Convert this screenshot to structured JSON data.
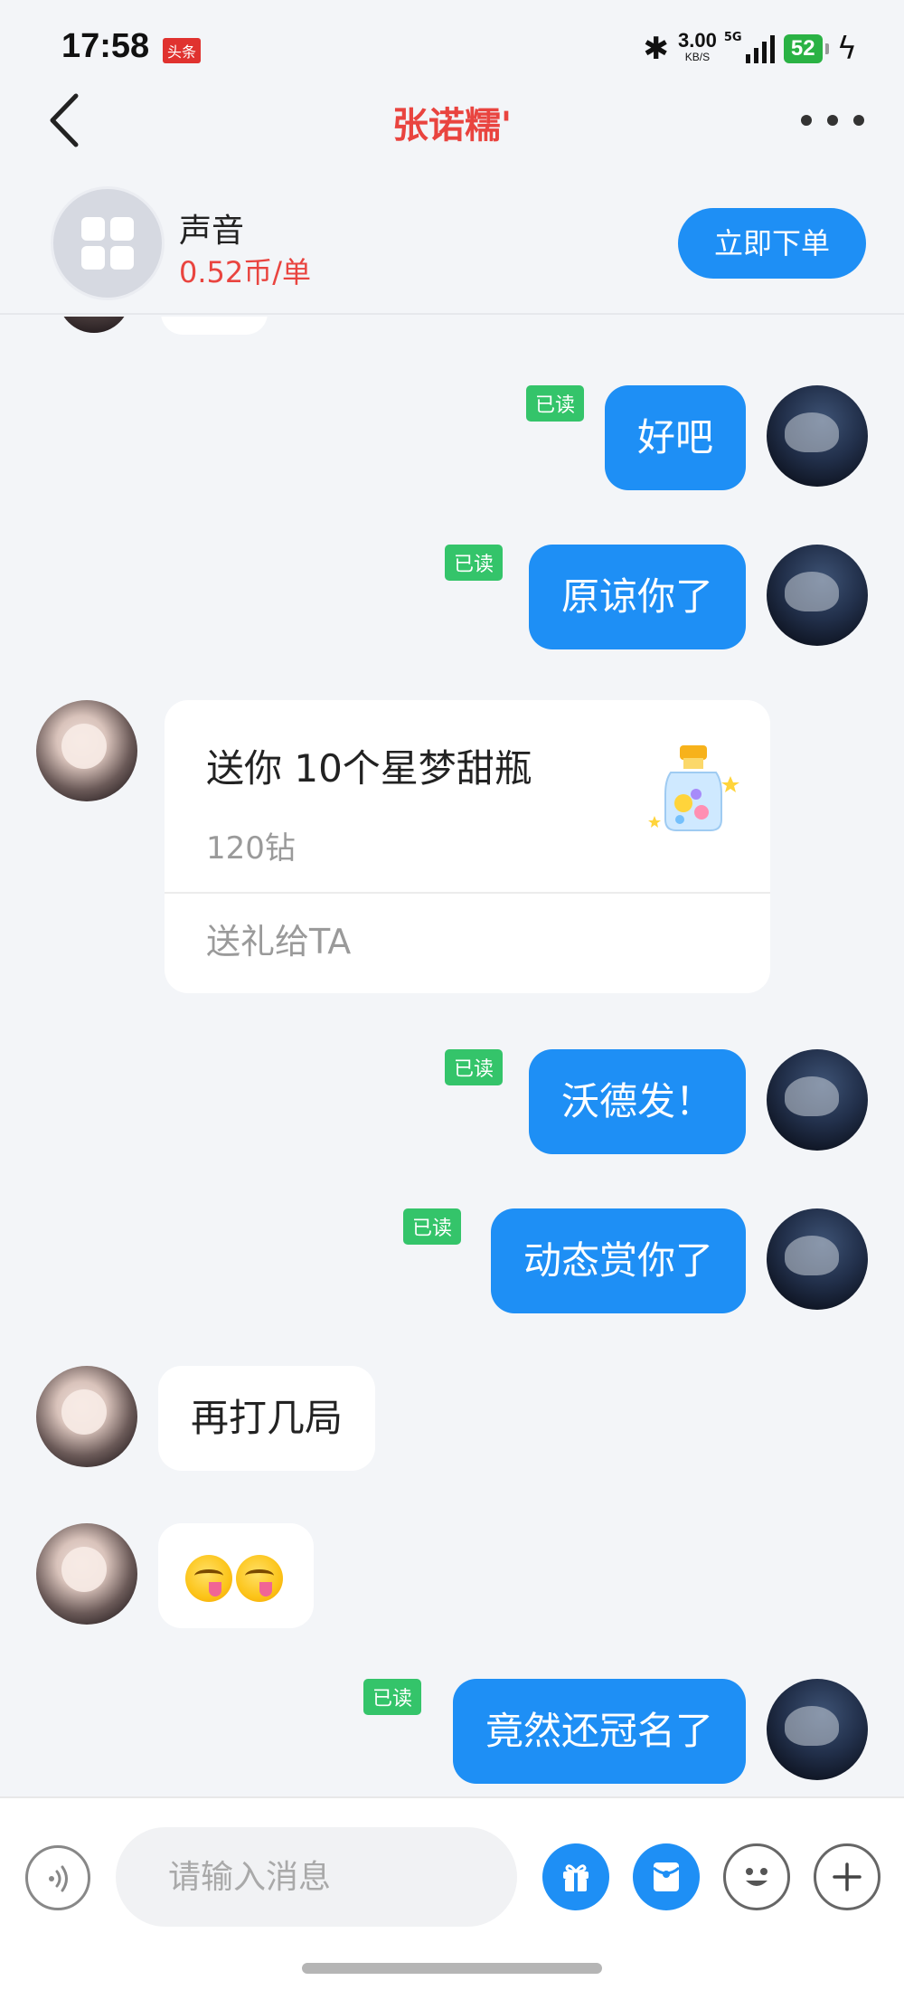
{
  "status_bar": {
    "time": "17:58",
    "news_badge": "头条",
    "speed_value": "3.00",
    "speed_unit": "KB/S",
    "network": "5G",
    "battery": "52"
  },
  "header": {
    "title": "张诺糯'"
  },
  "service": {
    "name": "声音",
    "price": "0.52币/单",
    "order_label": "立即下单"
  },
  "read_label": "已读",
  "messages": [
    {
      "from": "me",
      "text": "好吧",
      "read": true
    },
    {
      "from": "me",
      "text": "原谅你了",
      "read": true
    },
    {
      "from": "her",
      "type": "gift",
      "title": "送你 10个星梦甜瓶",
      "price": "120钻",
      "action": "送礼给TA"
    },
    {
      "from": "me",
      "text": "沃德发！",
      "read": true
    },
    {
      "from": "me",
      "text": "动态赏你了",
      "read": true
    },
    {
      "from": "her",
      "text": "再打几局"
    },
    {
      "from": "her",
      "type": "emoji",
      "emoji_name": "yum-face-icon",
      "emoji_count": 2
    },
    {
      "from": "me",
      "text": "竟然还冠名了",
      "read": true
    }
  ],
  "input": {
    "placeholder": "请输入消息"
  }
}
